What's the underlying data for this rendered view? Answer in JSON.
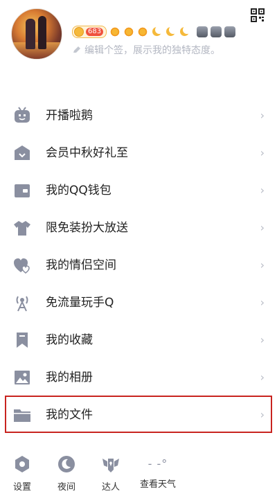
{
  "header": {
    "level_number": "683",
    "signature_placeholder": "编辑个签，展示我的独特态度。"
  },
  "menu": {
    "items": [
      {
        "label": "开播啦鹅",
        "icon": "live-broadcast-icon"
      },
      {
        "label": "会员中秋好礼至",
        "icon": "crown-basket-icon"
      },
      {
        "label": "我的QQ钱包",
        "icon": "wallet-icon"
      },
      {
        "label": "限免装扮大放送",
        "icon": "tshirt-icon"
      },
      {
        "label": "我的情侣空间",
        "icon": "hearts-icon"
      },
      {
        "label": "免流量玩手Q",
        "icon": "signal-tower-icon"
      },
      {
        "label": "我的收藏",
        "icon": "bookmark-icon"
      },
      {
        "label": "我的相册",
        "icon": "photo-album-icon"
      },
      {
        "label": "我的文件",
        "icon": "folder-icon"
      }
    ],
    "chevron": "›"
  },
  "bottom_bar": {
    "items": [
      {
        "label": "设置",
        "icon": "settings-gear-icon"
      },
      {
        "label": "夜间",
        "icon": "night-mode-icon"
      },
      {
        "label": "达人",
        "icon": "expert-wings-icon"
      },
      {
        "label": "查看天气",
        "icon": "weather-icon"
      }
    ],
    "weather_display": "- -°"
  },
  "colors": {
    "icon_gray": "#8a8fa0",
    "highlight_red": "#c8231f",
    "text_main": "#222222",
    "text_hint": "#b3b7c2"
  }
}
